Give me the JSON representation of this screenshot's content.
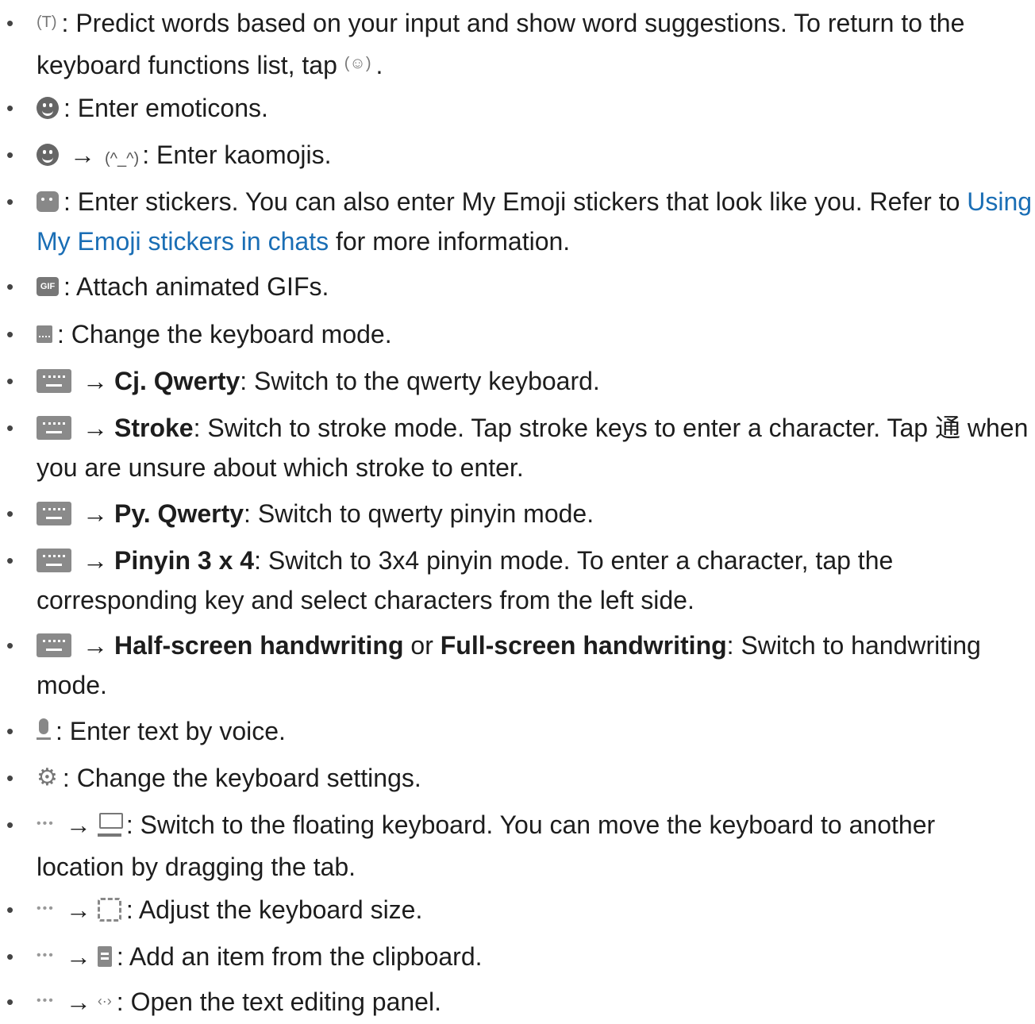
{
  "items": [
    {
      "lines": [
        "Predict words based on your input and show word suggestions. To return to the",
        "keyboard functions list, tap"
      ],
      "icon": "predict-icon",
      "return_icon": "return-icon"
    },
    {
      "text": ": Enter emoticons.",
      "icon": "emoticon-icon"
    },
    {
      "arrow": "→",
      "kaomoji_label": "(^_^)",
      "text": ": Enter kaomojis.",
      "icon": "emoticon-icon"
    },
    {
      "lines": [
        ": Enter stickers. You can also enter My Emoji stickers that look like you. Refer to",
        "for more information."
      ],
      "link1": "Using",
      "link2": "My Emoji stickers in chats",
      "icon": "sticker-icon"
    },
    {
      "text": ": Attach animated GIFs.",
      "icon_label": "GIF",
      "icon": "gif-icon"
    },
    {
      "text": ": Change the keyboard mode.",
      "icon": "keyboard-mode-icon"
    },
    {
      "arrow": "→",
      "bold": "Cj. Qwerty",
      "text": ": Switch to the qwerty keyboard.",
      "icon": "keyboard-icon"
    },
    {
      "arrow": "→",
      "bold": "Stroke",
      "lines": [
        ": Switch to stroke mode. Tap stroke keys to enter a character. Tap 通 when",
        "you are unsure about which stroke to enter."
      ],
      "icon": "keyboard-icon"
    },
    {
      "arrow": "→",
      "bold": "Py. Qwerty",
      "text": ": Switch to qwerty pinyin mode.",
      "icon": "keyboard-icon"
    },
    {
      "arrow": "→",
      "bold": "Pinyin 3 x 4",
      "lines": [
        ": Switch to 3x4 pinyin mode. To enter a character, tap the",
        "corresponding key and select characters from the left side."
      ],
      "icon": "keyboard-icon"
    },
    {
      "arrow": "→",
      "bold": "Half-screen handwriting",
      "or": "or",
      "bold2": "Full-screen handwriting",
      "lines": [
        ": Switch to handwriting",
        "mode."
      ],
      "icon": "keyboard-icon"
    },
    {
      "text": ": Enter text by voice.",
      "icon": "microphone-icon"
    },
    {
      "text": ": Change the keyboard settings.",
      "icon": "settings-icon"
    },
    {
      "dots": "•••",
      "arrow": "→",
      "lines": [
        ": Switch to the floating keyboard. You can move the keyboard to another",
        "location by dragging the tab."
      ],
      "icon": "floating-keyboard-icon"
    },
    {
      "dots": "•••",
      "arrow": "→",
      "text": ": Adjust the keyboard size.",
      "icon": "resize-icon"
    },
    {
      "dots": "•••",
      "arrow": "→",
      "text": ": Add an item from the clipboard.",
      "icon": "clipboard-icon"
    },
    {
      "dots": "•••",
      "arrow": "→",
      "text": ": Open the text editing panel.",
      "icon": "text-editing-icon"
    }
  ],
  "bullet": "•",
  "colors": {
    "text": "#1d1d1d",
    "link": "#1a6eb5"
  }
}
